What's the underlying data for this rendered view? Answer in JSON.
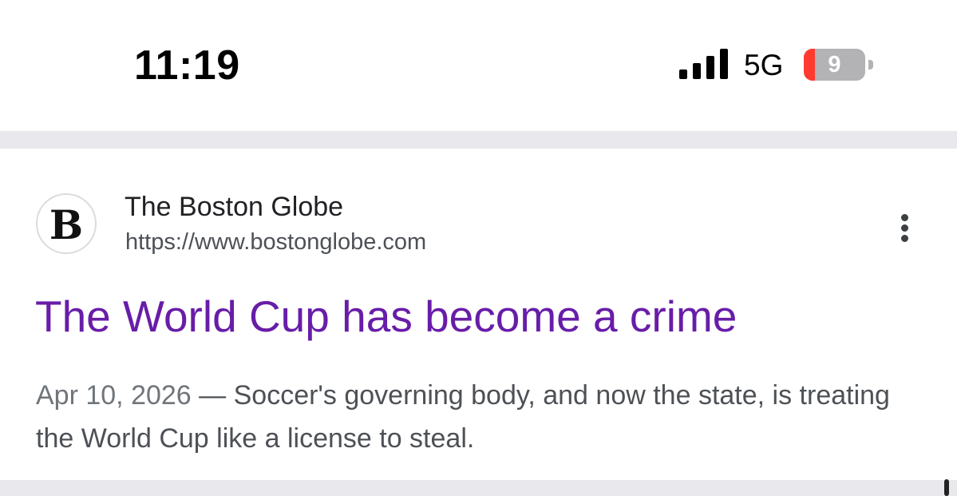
{
  "status_bar": {
    "time": "11:19",
    "network": "5G",
    "battery_level": "9",
    "signal_icon": "cellular-signal-icon",
    "battery_icon": "battery-low-icon",
    "battery_color": "#ff3b30"
  },
  "result": {
    "site_name": "The Boston Globe",
    "site_url": "https://www.bostonglobe.com",
    "favicon_icon": "boston-globe-logo-icon",
    "favicon_letter": "B",
    "more_icon": "more-vertical-icon",
    "title": "The World Cup has become a crime",
    "title_color": "#681da8",
    "date": "Apr 10, 2026",
    "date_separator": " — ",
    "snippet": "Soccer's governing body, and now the state, is treating the World Cup like a license to steal."
  }
}
